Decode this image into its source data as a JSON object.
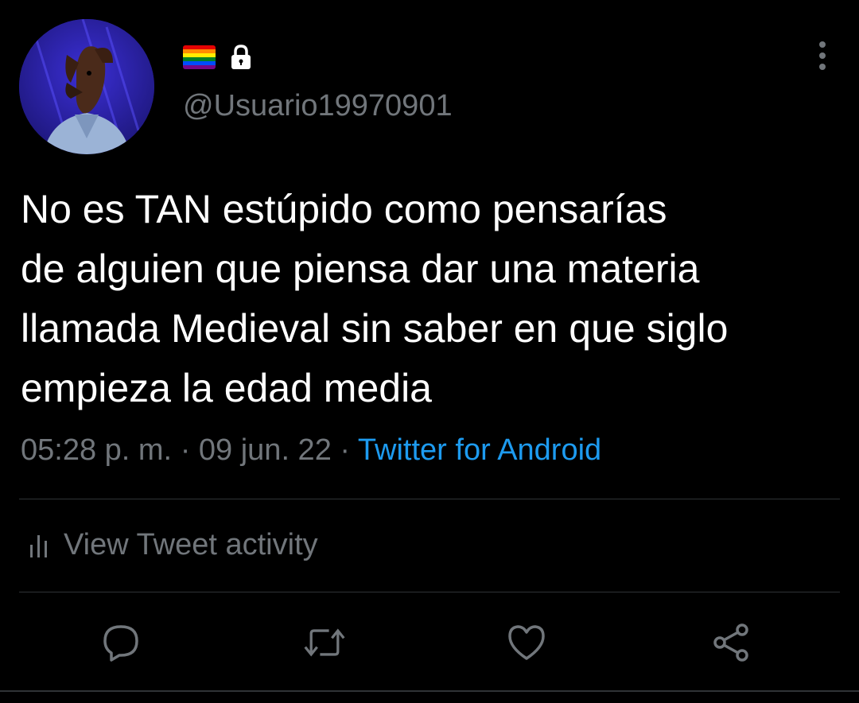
{
  "tweet": {
    "handle": "@Usuario19970901",
    "text_lines": [
      "No es TAN estúpido como pensarías",
      "de alguien que piensa dar una materia",
      "llamada Medieval sin saber en que siglo",
      "empieza la edad media"
    ],
    "time": "05:28 p. m.",
    "separator": "·",
    "date": "09 jun. 22",
    "source": "Twitter for Android",
    "activity_label": "View Tweet activity"
  },
  "icons": {
    "name_flag": "rainbow-flag-icon",
    "name_lock": "lock-icon",
    "more": "more-vertical-icon",
    "activity": "bar-chart-icon",
    "reply": "reply-icon",
    "retweet": "retweet-icon",
    "like": "heart-icon",
    "share": "share-icon"
  },
  "colors": {
    "background": "#000000",
    "text_primary": "#ffffff",
    "text_secondary": "#71767b",
    "link": "#1d9bf0",
    "divider": "#2f3336"
  }
}
